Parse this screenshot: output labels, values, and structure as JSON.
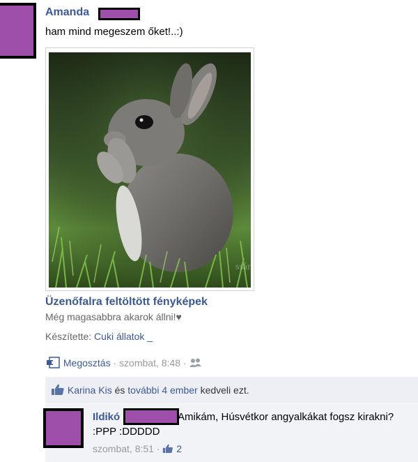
{
  "post": {
    "author": "Amanda",
    "text": "ham mind megeszem őket!..:)",
    "album_title": "Üzenőfalra feltöltött fényképek",
    "caption": "Még magasabbra akarok állni!♥",
    "credit_label": "Készítette:",
    "credit_value": "Cuki állatok _",
    "watermark": "ssár"
  },
  "actions": {
    "share": "Megosztás",
    "separator": "·",
    "time": "szombat, 8:48",
    "audience_icon": "friends-icon",
    "share_icon": "share-icon"
  },
  "likes": {
    "like_icon": "thumbs-up-icon",
    "name": "Karina Kis",
    "and": "és",
    "others": "további 4 ember",
    "suffix": "kedveli ezt."
  },
  "comment": {
    "author": "Ildikó",
    "text_line1": "Amikám, Húsvétkor angyalkákat fogsz kirakni?",
    "text_line2": ":PPP :DDDDD",
    "time": "szombat, 8:51",
    "separator": "·",
    "like_count": "2"
  },
  "colors": {
    "link": "#3b5998",
    "redaction_fill": "#9e4fa9",
    "feedback_bg": "#edeff4"
  }
}
